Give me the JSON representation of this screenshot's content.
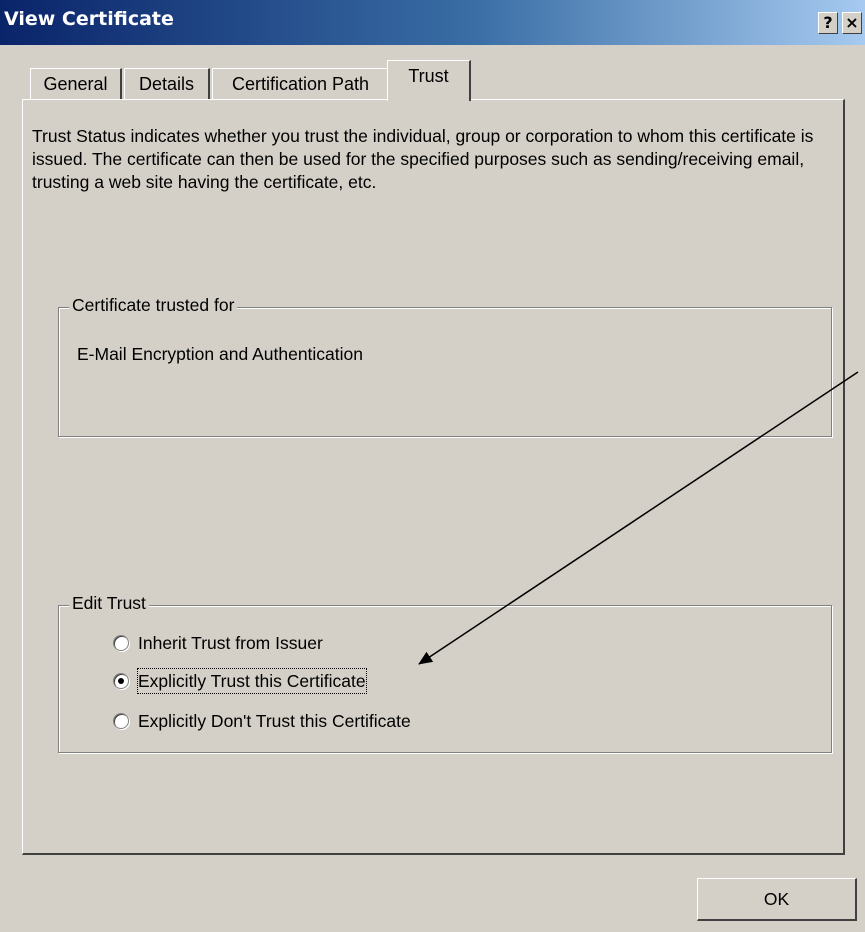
{
  "window": {
    "title": "View Certificate",
    "help_button": "?",
    "close_button": "×"
  },
  "tabs": [
    {
      "label": "General"
    },
    {
      "label": "Details"
    },
    {
      "label": "Certification Path"
    },
    {
      "label": "Trust",
      "active": true
    }
  ],
  "intro_text": "Trust Status indicates whether you trust the individual, group or corporation to whom this certificate is issued.  The certificate can then be used for the specified purposes such as sending/receiving email, trusting a web site having the certificate, etc.",
  "trusted_for": {
    "label": "Certificate trusted for",
    "value": "E-Mail Encryption and Authentication"
  },
  "edit_trust": {
    "label": "Edit Trust",
    "options": [
      {
        "label": "Inherit Trust from Issuer",
        "checked": false
      },
      {
        "label": "Explicitly Trust this Certificate",
        "checked": true
      },
      {
        "label": "Explicitly Don't Trust this Certificate",
        "checked": false
      }
    ]
  },
  "ok_button": "OK"
}
